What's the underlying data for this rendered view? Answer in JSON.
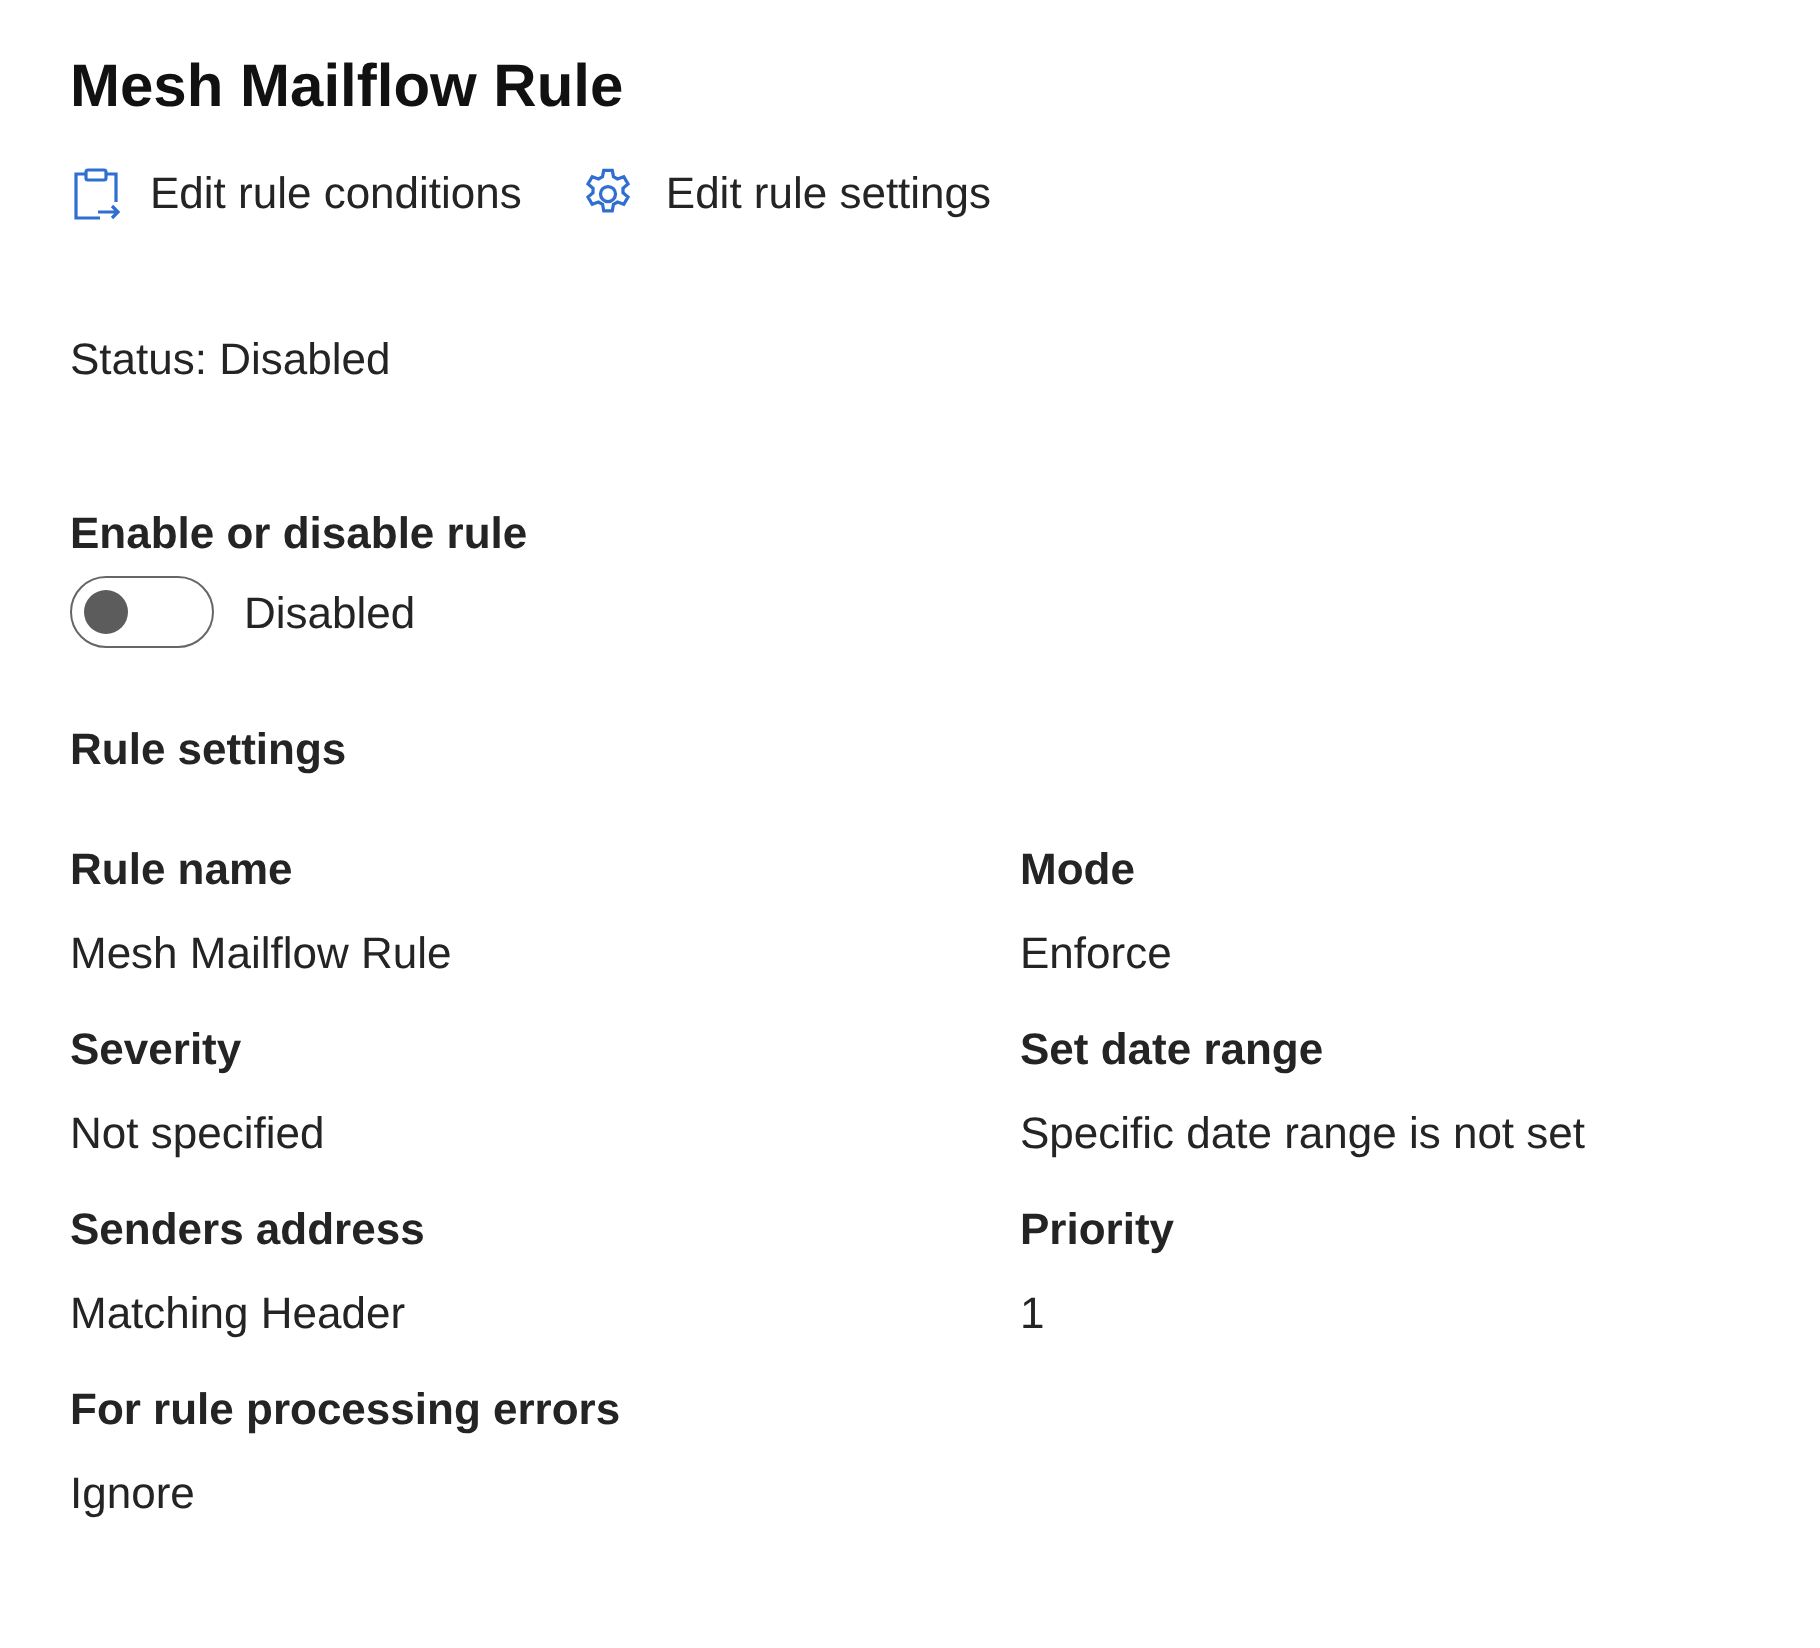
{
  "title": "Mesh Mailflow Rule",
  "actions": [
    {
      "kind": "clipboard",
      "label": "Edit rule conditions"
    },
    {
      "kind": "gear",
      "label": "Edit rule settings"
    }
  ],
  "status": "Status: Disabled",
  "toggle": {
    "label": "Enable or disable rule",
    "on": false,
    "text": "Disabled"
  },
  "section_title": "Rule settings",
  "fields": [
    {
      "label": "Rule name",
      "value": "Mesh Mailflow Rule"
    },
    {
      "label": "Mode",
      "value": "Enforce"
    },
    {
      "label": "Severity",
      "value": "Not specified"
    },
    {
      "label": "Set date range",
      "value": "Specific date range is not set"
    },
    {
      "label": "Senders address",
      "value": "Matching Header"
    },
    {
      "label": "Priority",
      "value": "1"
    },
    {
      "label": "For rule processing errors",
      "value": "Ignore"
    }
  ]
}
